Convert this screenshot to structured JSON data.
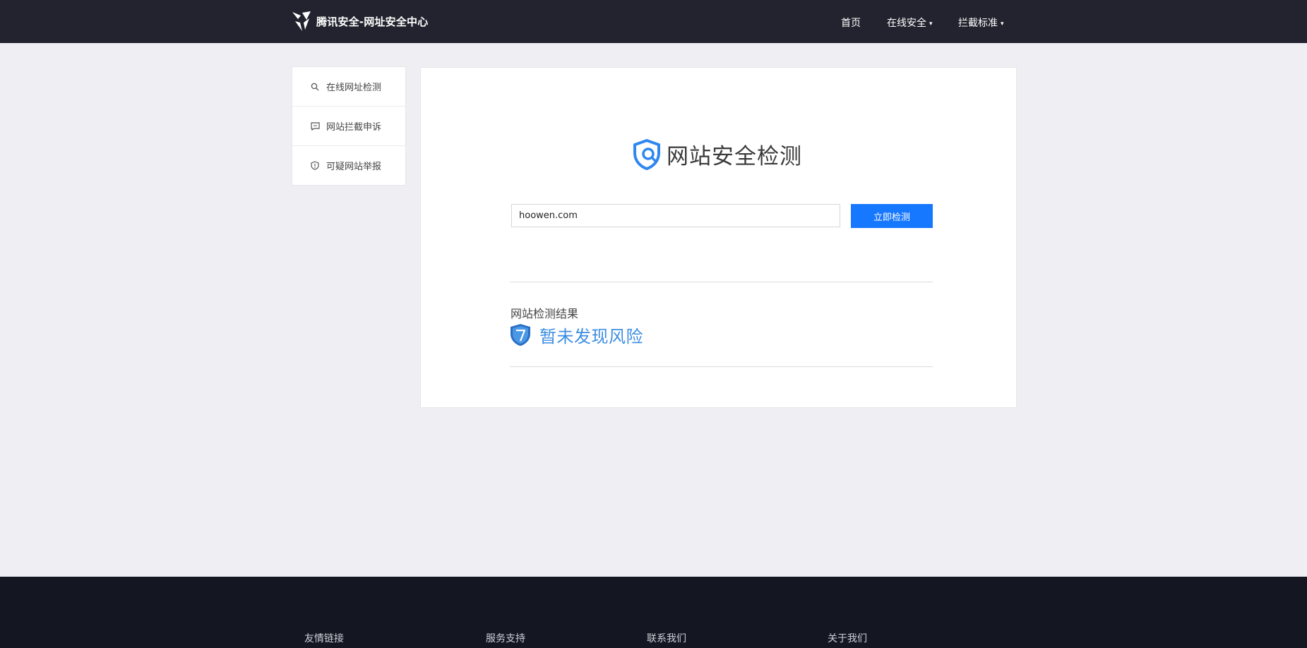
{
  "header": {
    "brand_title": "腾讯安全-网址安全中心",
    "nav": [
      {
        "label": "首页"
      },
      {
        "label": "在线安全",
        "caret": "▾"
      },
      {
        "label": "拦截标准",
        "caret": "▾"
      }
    ]
  },
  "sidebar": {
    "items": [
      {
        "label": "在线网址检测",
        "icon": "search-icon"
      },
      {
        "label": "网站拦截申诉",
        "icon": "chat-icon"
      },
      {
        "label": "可疑网站举报",
        "icon": "shield-alert-icon"
      }
    ]
  },
  "main": {
    "title": "网站安全检测",
    "search": {
      "value": "hoowen.com",
      "button_label": "立即检测"
    },
    "result": {
      "heading": "网站检测结果",
      "status": "暂未发现风险"
    }
  },
  "footer": {
    "columns": [
      "友情链接",
      "服务支持",
      "联系我们",
      "关于我们"
    ]
  },
  "colors": {
    "header_bg": "#22232e",
    "page_bg": "#efeef3",
    "accent": "#1677ff",
    "result_text": "#3d8ee0",
    "footer_bg": "#141622"
  }
}
